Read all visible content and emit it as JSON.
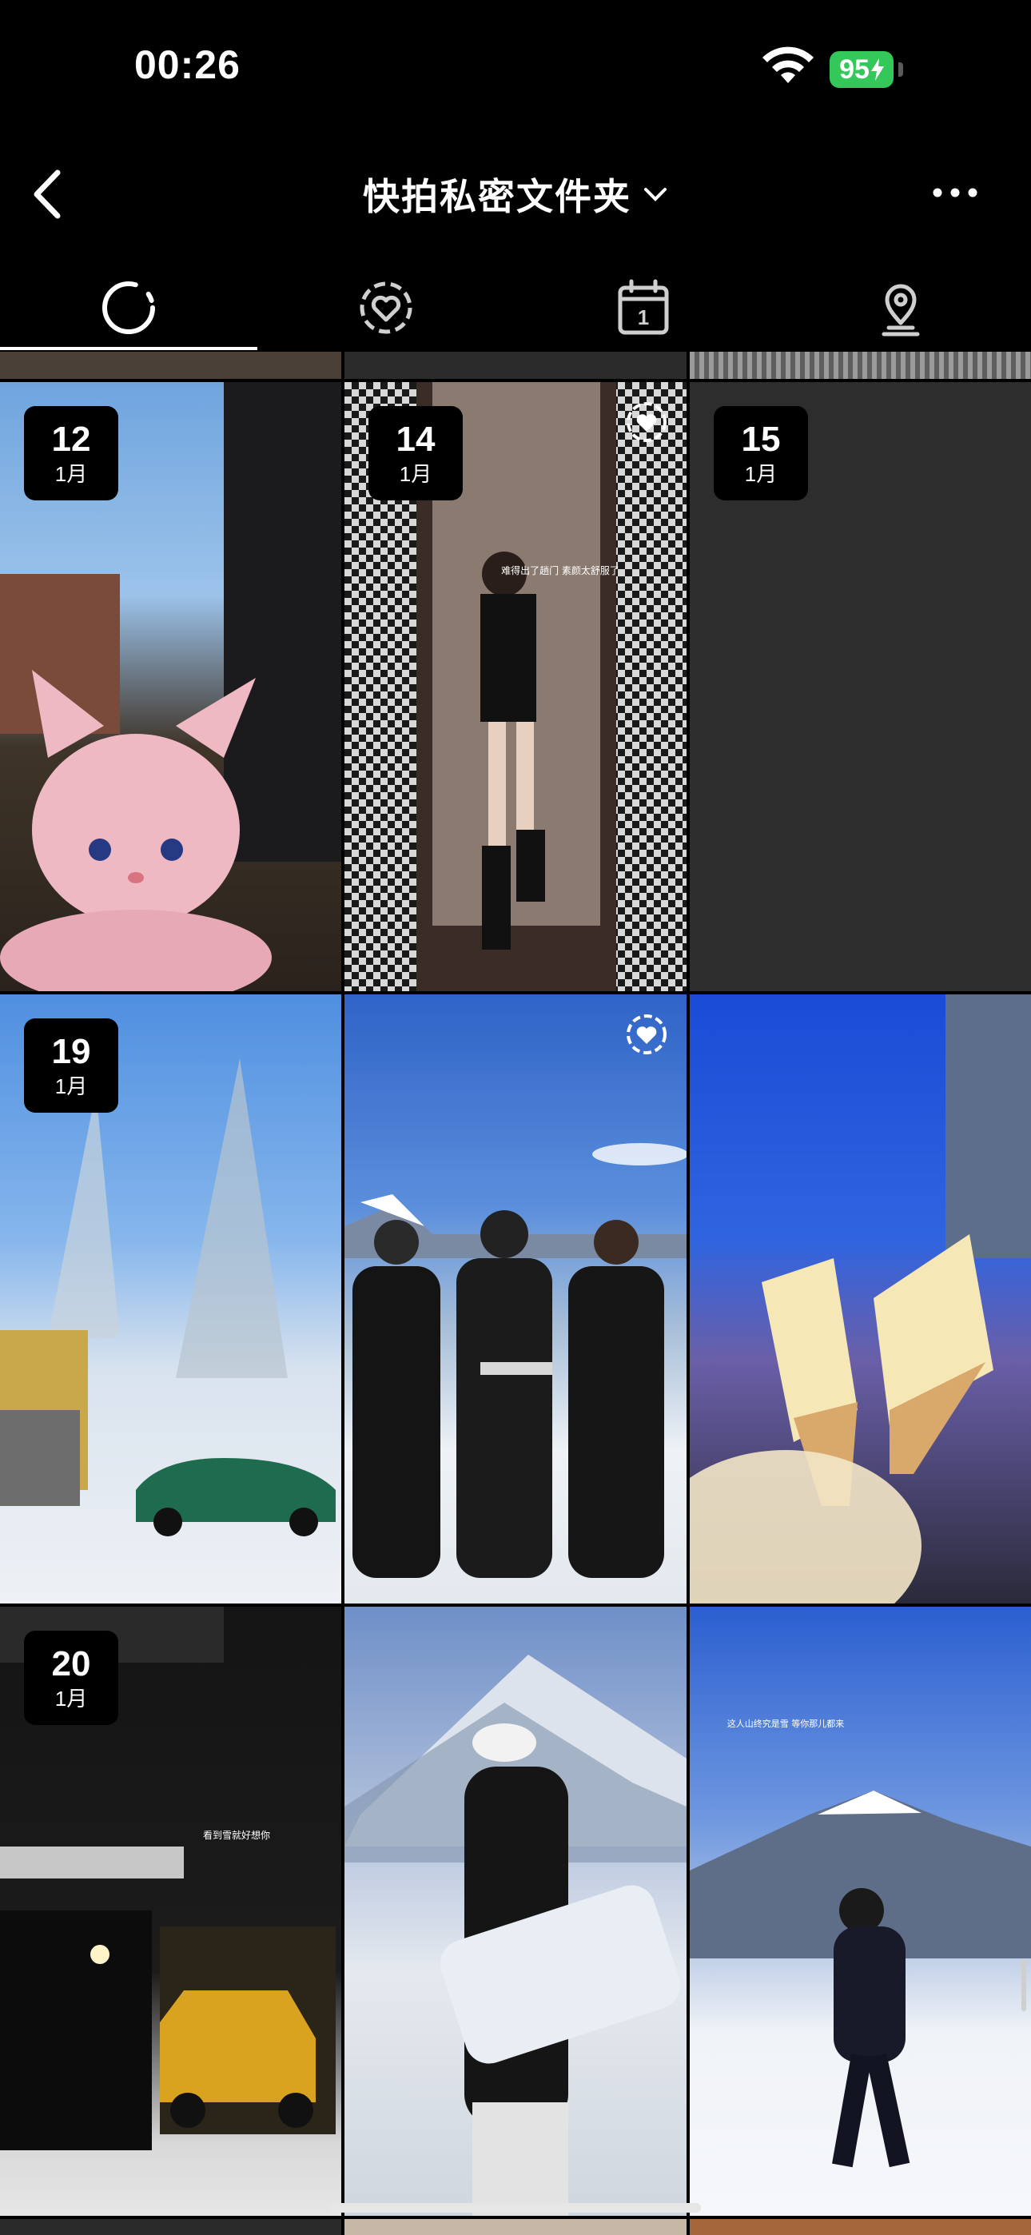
{
  "status_bar": {
    "time": "00:26",
    "battery": "95"
  },
  "header": {
    "title": "快拍私密文件夹"
  },
  "tabs": [
    {
      "icon": "all-stories-icon",
      "active": true
    },
    {
      "icon": "favorites-heart-icon",
      "active": false
    },
    {
      "icon": "calendar-icon",
      "label": "1",
      "active": false
    },
    {
      "icon": "location-pin-icon",
      "active": false
    }
  ],
  "photos": [
    {
      "day": "12",
      "month": "1月",
      "subject": "pink plush cat toy by window",
      "favorite": false
    },
    {
      "day": "14",
      "month": "1月",
      "subject": "mirror selfie in checkered elevator",
      "favorite": true,
      "overlay_text": "难得出了趟门 素颜太舒服了"
    },
    {
      "day": "15",
      "month": "1月",
      "subject": "empty dark tile",
      "favorite": false
    },
    {
      "day": "19",
      "month": "1月",
      "subject": "snowy street with green sports car",
      "favorite": false
    },
    {
      "subject": "three skiers posing in front of mountain",
      "favorite": true
    },
    {
      "subject": "two soft-serve ice creams at dusk",
      "favorite": false
    },
    {
      "day": "20",
      "month": "1月",
      "subject": "night house with yellow SUV",
      "favorite": false,
      "overlay_text": "看到雪就好想你"
    },
    {
      "subject": "snowboarder with board, mountain behind",
      "favorite": false
    },
    {
      "subject": "skier on slope with snowy mountain",
      "favorite": false,
      "overlay_text": "这人山终究是雪 等你那儿都来"
    }
  ],
  "colors": {
    "background": "#000000",
    "battery": "#34c759",
    "empty_tile": "#2d2d2d"
  }
}
